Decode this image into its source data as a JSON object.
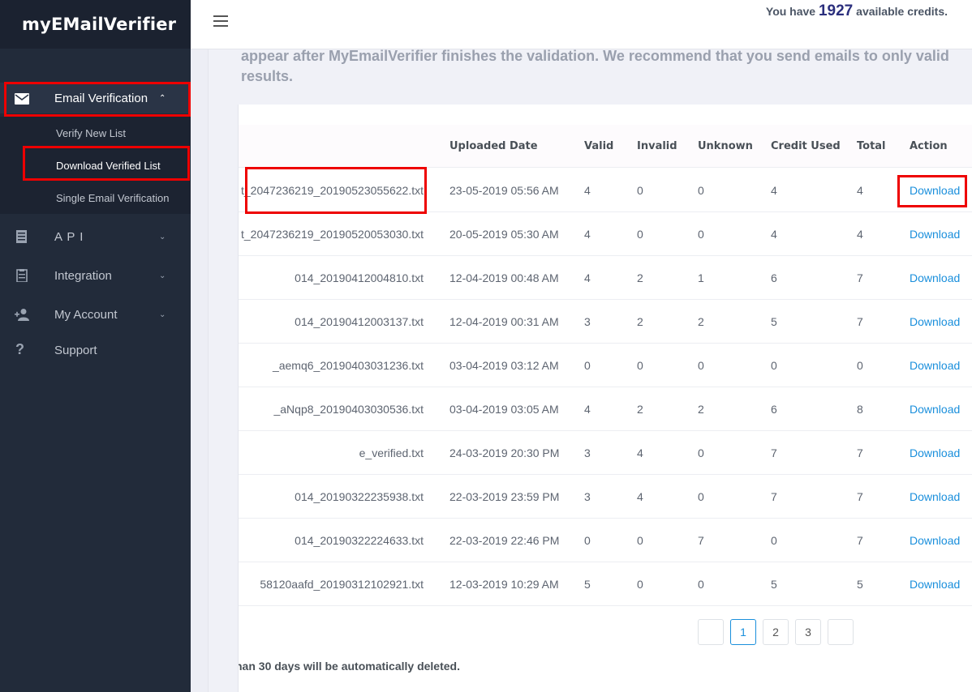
{
  "brand": {
    "name": "myEMailVerifier"
  },
  "sidebar": {
    "items": [
      {
        "label": "Email Verification",
        "icon": "envelope-icon",
        "expanded": true
      },
      {
        "label": "A P I",
        "icon": "document-icon"
      },
      {
        "label": "Integration",
        "icon": "clipboard-icon"
      },
      {
        "label": "My Account",
        "icon": "user-add-icon"
      },
      {
        "label": "Support",
        "icon": "question-icon"
      }
    ],
    "sub_items": [
      "Verify New List",
      "Download Verified List",
      "Single Email Verification"
    ]
  },
  "topbar": {
    "credits_prefix": "You have",
    "credits_value": "1927",
    "credits_suffix": "available credits."
  },
  "notice": "appear after MyEmailVerifier finishes the validation. We recommend that you send emails to only valid results.",
  "table": {
    "headers": [
      "Uploaded Date",
      "Valid",
      "Invalid",
      "Unknown",
      "Credit Used",
      "Total",
      "Action"
    ],
    "rows": [
      {
        "file": "t_2047236219_20190523055622.txt",
        "date": "23-05-2019 05:56 AM",
        "valid": "4",
        "invalid": "0",
        "unknown": "0",
        "credit": "4",
        "total": "4",
        "action": "Download"
      },
      {
        "file": "t_2047236219_20190520053030.txt",
        "date": "20-05-2019 05:30 AM",
        "valid": "4",
        "invalid": "0",
        "unknown": "0",
        "credit": "4",
        "total": "4",
        "action": "Download"
      },
      {
        "file": "014_20190412004810.txt",
        "date": "12-04-2019 00:48 AM",
        "valid": "4",
        "invalid": "2",
        "unknown": "1",
        "credit": "6",
        "total": "7",
        "action": "Download"
      },
      {
        "file": "014_20190412003137.txt",
        "date": "12-04-2019 00:31 AM",
        "valid": "3",
        "invalid": "2",
        "unknown": "2",
        "credit": "5",
        "total": "7",
        "action": "Download"
      },
      {
        "file": "_aemq6_20190403031236.txt",
        "date": "03-04-2019 03:12 AM",
        "valid": "0",
        "invalid": "0",
        "unknown": "0",
        "credit": "0",
        "total": "0",
        "action": "Download"
      },
      {
        "file": "_aNqp8_20190403030536.txt",
        "date": "03-04-2019 03:05 AM",
        "valid": "4",
        "invalid": "2",
        "unknown": "2",
        "credit": "6",
        "total": "8",
        "action": "Download"
      },
      {
        "file": "e_verified.txt",
        "date": "24-03-2019 20:30 PM",
        "valid": "3",
        "invalid": "4",
        "unknown": "0",
        "credit": "7",
        "total": "7",
        "action": "Download"
      },
      {
        "file": "014_20190322235938.txt",
        "date": "22-03-2019 23:59 PM",
        "valid": "3",
        "invalid": "4",
        "unknown": "0",
        "credit": "7",
        "total": "7",
        "action": "Download"
      },
      {
        "file": "014_20190322224633.txt",
        "date": "22-03-2019 22:46 PM",
        "valid": "0",
        "invalid": "0",
        "unknown": "7",
        "credit": "0",
        "total": "7",
        "action": "Download"
      },
      {
        "file": "58120aafd_20190312102921.txt",
        "date": "12-03-2019 10:29 AM",
        "valid": "5",
        "invalid": "0",
        "unknown": "0",
        "credit": "5",
        "total": "5",
        "action": "Download"
      }
    ]
  },
  "pagination": {
    "pages": [
      "",
      "1",
      "2",
      "3",
      ""
    ],
    "current": "1"
  },
  "footnote": "han 30 days will be automatically deleted."
}
